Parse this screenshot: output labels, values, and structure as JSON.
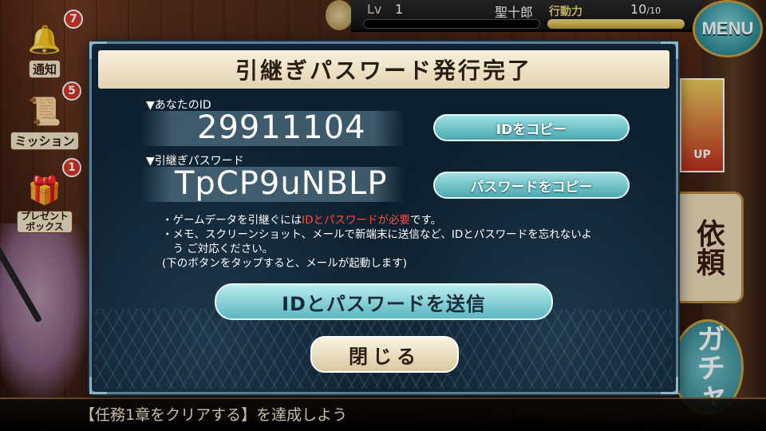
{
  "topbar": {
    "lv_label": "Lv",
    "lv_value": "1",
    "player_name": "聖十郎",
    "ap_label": "行動力",
    "ap_current": "10",
    "ap_max": "/10",
    "ap_fill_fraction": 1.0,
    "menu_label": "MENU"
  },
  "sidebar": {
    "items": [
      {
        "label": "通知",
        "badge": "7",
        "icon": "bell-icon"
      },
      {
        "label": "ミッション",
        "badge": "5",
        "icon": "scroll-check-icon"
      },
      {
        "label": "プレゼント\nボックス",
        "badge": "1",
        "icon": "gift-icon"
      }
    ]
  },
  "right_menu": {
    "irai_label": "依頼",
    "gacha_label": "ガチャ",
    "banner_label": "UP"
  },
  "modal": {
    "title": "引継ぎパスワード発行完了",
    "id_label": "▼あなたのID",
    "id_value": "29911104",
    "copy_id_label": "IDをコピー",
    "pw_label": "▼引継ぎパスワード",
    "pw_value": "TpCP9uNBLP",
    "copy_pw_label": "パスワードをコピー",
    "note_line1_a": "・ゲームデータを引継ぐには",
    "note_line1_b": "IDとパスワードが必要",
    "note_line1_c": "です。",
    "note_line2": "・メモ、スクリーンショット、メールで新端末に送信など、IDとパスワードを忘れないよ",
    "note_line3": "　う ご対応ください。",
    "note_line4": "(下のボタンをタップすると、メールが起動します)",
    "send_label": "IDとパスワードを送信",
    "close_label": "閉じる"
  },
  "bottom": {
    "message": "【任務1章をクリアする】を達成しよう"
  },
  "colors": {
    "accent_teal": "#4aa8b2",
    "title_cream": "#f7f0dc",
    "note_red": "#ff4a3a",
    "modal_bg": "#0e2232"
  }
}
